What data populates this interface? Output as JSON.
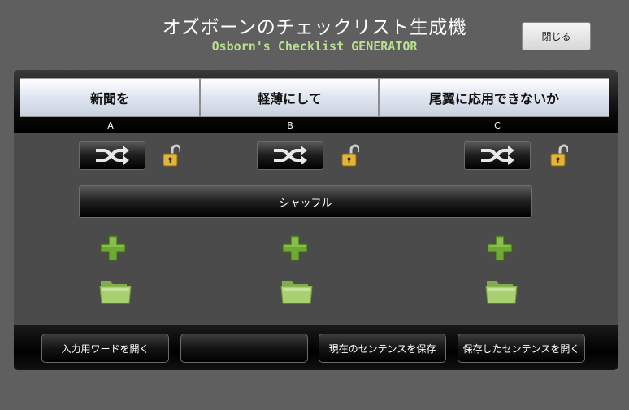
{
  "header": {
    "title": "オズボーンのチェックリスト生成機",
    "subtitle": "Osborn's Checklist GENERATOR",
    "close_label": "閉じる"
  },
  "columns": [
    {
      "word": "新聞を",
      "label": "A",
      "shuffle_icon": "shuffle-icon",
      "lock_icon": "unlocked-padlock-icon"
    },
    {
      "word": "軽薄にして",
      "label": "B",
      "shuffle_icon": "shuffle-icon",
      "lock_icon": "unlocked-padlock-icon"
    },
    {
      "word": "尾翼に応用できないか",
      "label": "C",
      "shuffle_icon": "shuffle-icon",
      "lock_icon": "unlocked-padlock-icon"
    }
  ],
  "shuffle_all_label": "シャッフル",
  "footer": {
    "open_input_words": "入力用ワードを開く",
    "empty_button": "",
    "save_sentence": "現在のセンテンスを保存",
    "open_saved_sentence": "保存したセンテンスを開く"
  },
  "colors": {
    "background": "#5f5f5f",
    "panel": "#4b4b4b",
    "subtitle": "#b9e08c",
    "plus_green": "#6fa832",
    "folder_green": "#a8d070",
    "lock_gold": "#e2b43a"
  }
}
